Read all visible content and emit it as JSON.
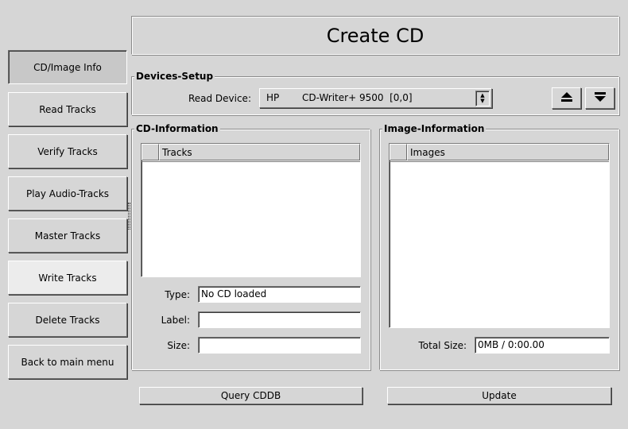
{
  "nav": {
    "items": [
      {
        "label": "CD/Image Info"
      },
      {
        "label": "Read Tracks"
      },
      {
        "label": "Verify Tracks"
      },
      {
        "label": "Play Audio-Tracks"
      },
      {
        "label": "Master Tracks"
      },
      {
        "label": "Write Tracks"
      },
      {
        "label": "Delete Tracks"
      },
      {
        "label": "Back to main menu"
      }
    ]
  },
  "header": {
    "title": "Create CD"
  },
  "devices": {
    "group_label": "Devices-Setup",
    "read_device_label": "Read Device:",
    "read_device_vendor": "HP",
    "read_device_model": "CD-Writer+ 9500  [0,0]",
    "eject_icon": "eject-icon",
    "load_icon": "load-tray-icon"
  },
  "cd_info": {
    "group_label": "CD-Information",
    "tracks_header": "Tracks",
    "type_label": "Type:",
    "type_value": "No CD loaded",
    "label_label": "Label:",
    "label_value": "",
    "size_label": "Size:",
    "size_value": ""
  },
  "image_info": {
    "group_label": "Image-Information",
    "images_header": "Images",
    "total_size_label": "Total Size:",
    "total_size_value": "0MB / 0:00.00"
  },
  "actions": {
    "query_cddb": "Query CDDB",
    "update": "Update"
  }
}
